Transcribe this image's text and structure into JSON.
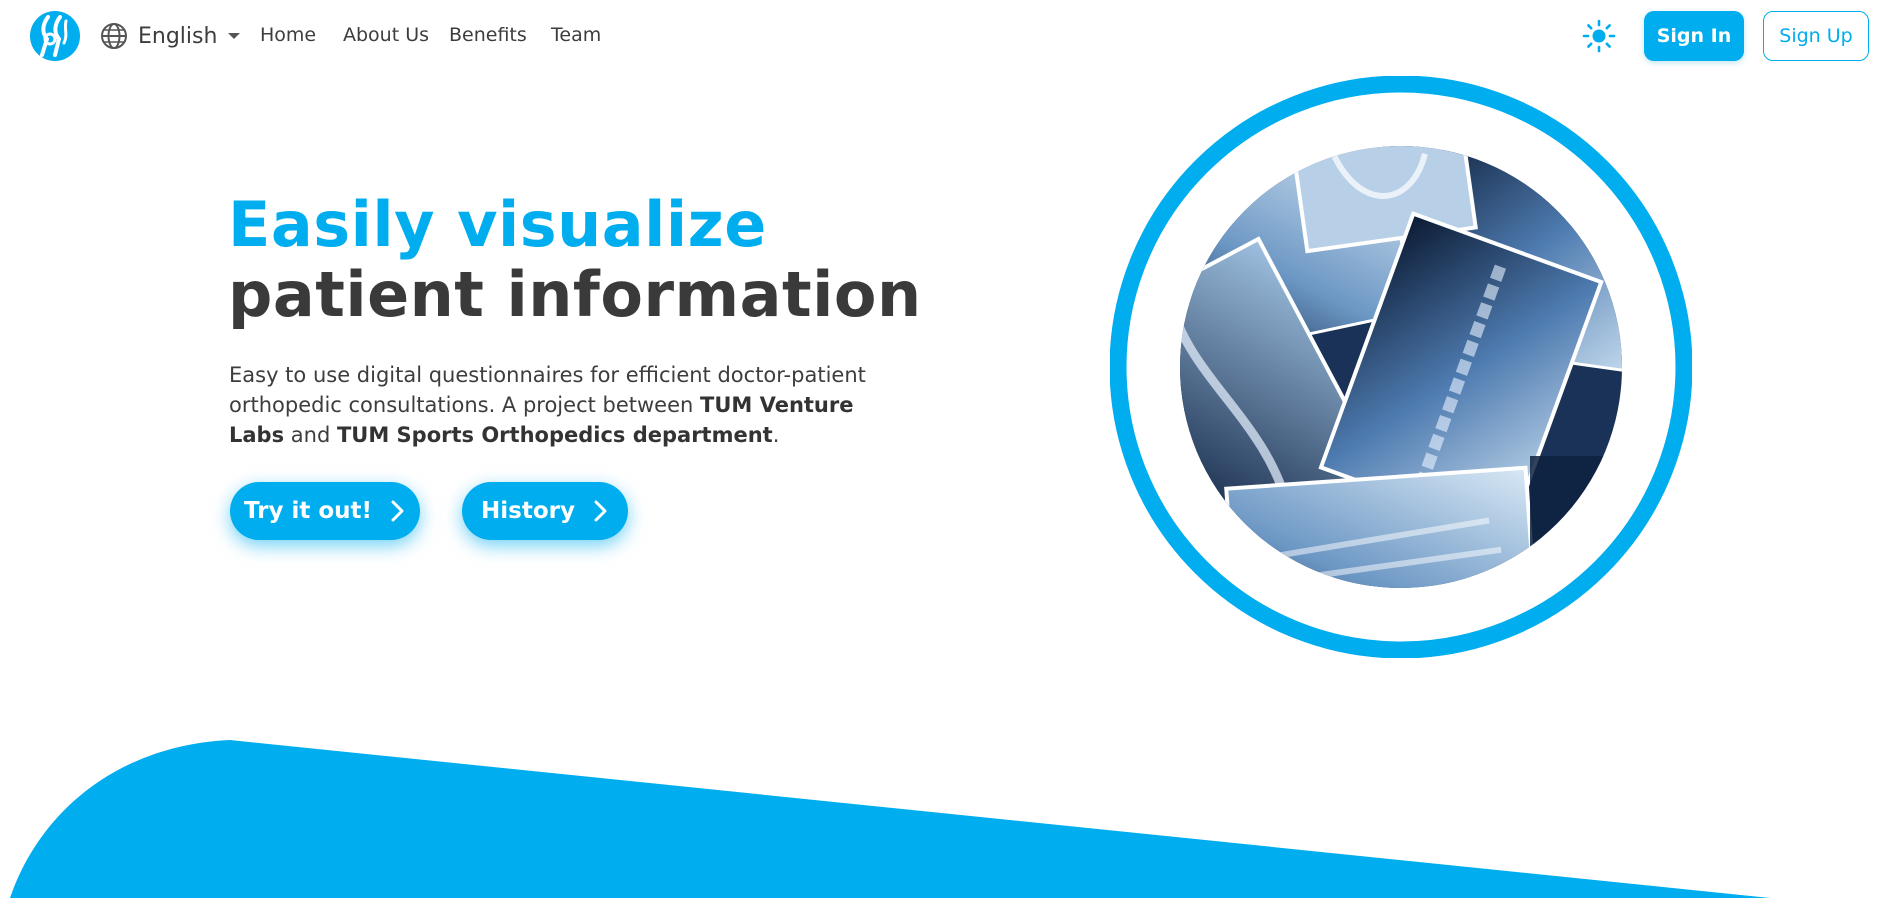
{
  "brand": {
    "accent_color": "#00adef",
    "logo_icon": "knee-joint-logo-icon"
  },
  "navbar": {
    "language": {
      "label": "English",
      "icon": "globe-icon"
    },
    "links": [
      "Home",
      "About Us",
      "Benefits",
      "Team"
    ],
    "theme_toggle_icon": "sun-icon",
    "sign_in": "Sign In",
    "sign_up": "Sign Up"
  },
  "hero": {
    "title_line1": "Easily visualize",
    "title_line2": "patient information",
    "description_part1": "Easy to use digital questionnaires for efficient doctor-patient orthopedic consultations. A project between ",
    "description_bold1": "TUM Venture Labs",
    "description_part2": " and ",
    "description_bold2": "TUM Sports Orthopedics department",
    "description_part3": ".",
    "buttons": {
      "try": "Try it out!",
      "history": "History"
    },
    "image_alt": "x-ray collage"
  }
}
